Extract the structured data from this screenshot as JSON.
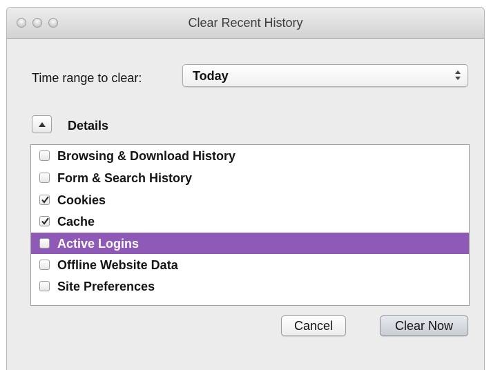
{
  "window": {
    "title": "Clear Recent History"
  },
  "time_range": {
    "label": "Time range to clear:",
    "selected": "Today"
  },
  "details": {
    "label": "Details",
    "expanded": true
  },
  "items": [
    {
      "label": "Browsing & Download History",
      "checked": false,
      "selected": false
    },
    {
      "label": "Form & Search History",
      "checked": false,
      "selected": false
    },
    {
      "label": "Cookies",
      "checked": true,
      "selected": false
    },
    {
      "label": "Cache",
      "checked": true,
      "selected": false
    },
    {
      "label": "Active Logins",
      "checked": false,
      "selected": true
    },
    {
      "label": "Offline Website Data",
      "checked": false,
      "selected": false
    },
    {
      "label": "Site Preferences",
      "checked": false,
      "selected": false
    }
  ],
  "buttons": {
    "cancel": "Cancel",
    "clear_now": "Clear Now"
  },
  "colors": {
    "selection": "#8f59b7",
    "window_bg": "#ececec"
  }
}
